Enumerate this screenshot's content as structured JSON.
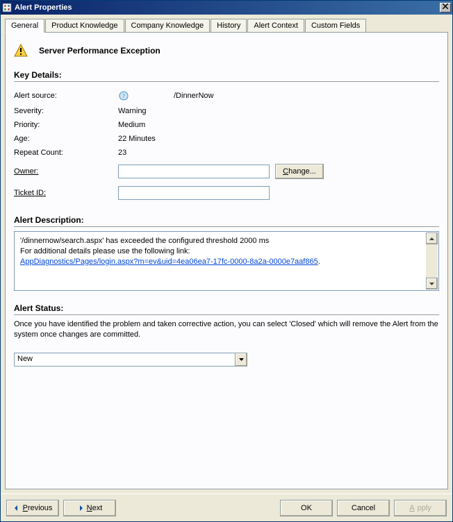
{
  "window": {
    "title": "Alert Properties"
  },
  "tabs": [
    {
      "label": "General"
    },
    {
      "label": "Product Knowledge"
    },
    {
      "label": "Company Knowledge"
    },
    {
      "label": "History"
    },
    {
      "label": "Alert Context"
    },
    {
      "label": "Custom Fields"
    }
  ],
  "heading": "Server Performance Exception",
  "key_details_label": "Key Details:",
  "fields": {
    "source_label": "Alert source:",
    "source_value": "/DinnerNow",
    "severity_label": "Severity:",
    "severity_value": "Warning",
    "priority_label": "Priority:",
    "priority_value": "Medium",
    "age_label": "Age:",
    "age_value": "22 Minutes",
    "repeat_label": "Repeat Count:",
    "repeat_value": "23",
    "owner_label_pre": "O",
    "owner_label_rest": "wner:",
    "owner_value": "",
    "ticket_label_pre": "T",
    "ticket_label_rest": "icket ID:",
    "ticket_value": "",
    "change_button": "Change..."
  },
  "description": {
    "label": "Alert Description:",
    "line1": "'/dinnernow/search.aspx' has exceeded the configured threshold 2000 ms",
    "line2": "For additional details please use the following link:",
    "link_text": "AppDiagnostics/Pages/login.aspx?m=ev&uid=4ea06ea7-17fc-0000-8a2a-0000e7aaf865",
    "period": "."
  },
  "status": {
    "label": "Alert Status:",
    "help_text": "Once you have identified the problem and taken corrective action, you can select 'Closed' which will remove the Alert from the system once changes are committed.",
    "selected": "New"
  },
  "footer": {
    "previous": "Previous",
    "next": "Next",
    "ok": "OK",
    "cancel": "Cancel",
    "apply": "Apply"
  }
}
